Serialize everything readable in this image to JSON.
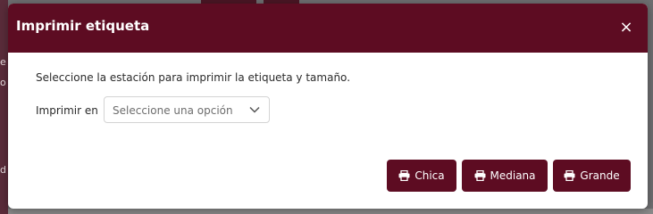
{
  "background": {
    "sidebar_fragments": [
      "e",
      "o",
      "d"
    ]
  },
  "modal": {
    "title": "Imprimir etiqueta",
    "close_glyph": "×",
    "description": "Seleccione la estación para imprimir la etiqueta y tamaño.",
    "station_field": {
      "label": "Imprimir en",
      "selected": "Seleccione una opción"
    },
    "buttons": [
      {
        "label": "Chica",
        "icon": "printer-icon"
      },
      {
        "label": "Mediana",
        "icon": "printer-icon"
      },
      {
        "label": "Grande",
        "icon": "printer-icon"
      }
    ]
  },
  "colors": {
    "brand": "#5d0c22",
    "text": "#2b2b2b",
    "placeholder": "#6d6d6d"
  }
}
